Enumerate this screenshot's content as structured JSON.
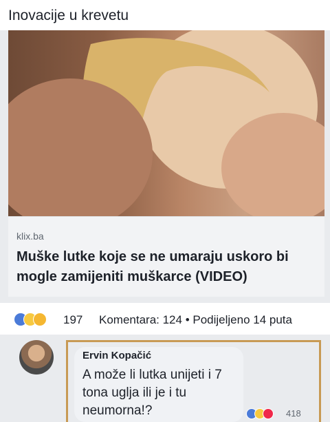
{
  "post": {
    "title": "Inovacije u krevetu",
    "link": {
      "domain": "klix.ba",
      "headline": "Muške lutke koje se ne umaraju uskoro bi mogle zamijeniti muškarce (VIDEO)"
    },
    "stats": {
      "reaction_count": "197",
      "meta": "Komentara: 124 • Podijeljeno 14 puta",
      "reactions": [
        "like-icon",
        "haha-icon",
        "wow-icon"
      ]
    }
  },
  "comment": {
    "author": "Ervin Kopačić",
    "text": "A može li lutka unijeti i 7 tona uglja ili je i tu neumorna!?",
    "reaction_count": "418",
    "reactions": [
      "like-icon",
      "haha-icon",
      "love-icon"
    ]
  },
  "colors": {
    "like": "#4b7bd8",
    "haha": "#f7c940",
    "love": "#f0284a",
    "highlight": "#c89a54"
  }
}
